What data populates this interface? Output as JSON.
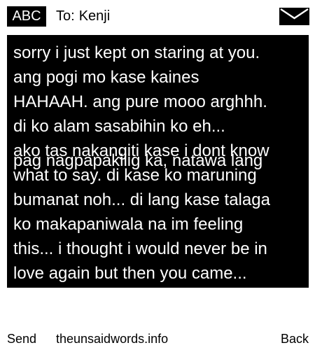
{
  "header": {
    "mode_label": "ABC",
    "to_label": "To:",
    "recipient": "Kenji",
    "icon": "envelope-icon"
  },
  "message": {
    "lines": [
      "sorry i just kept on staring at you.",
      "ang pogi mo kase kaines",
      "HAHAAH. ang pure mooo arghhh.",
      "di ko alam sasabihin ko eh...",
      "pag nagpapakilig ka, natawa lang",
      "ako tas nakangiti kase i dont know",
      "what to say. di kase ko maruning",
      "bumanat noh... di lang kase talaga",
      "ko makapaniwala na im feeling",
      "this... i thought i would never be in",
      "love again but then you came..."
    ]
  },
  "softkeys": {
    "left": "Send",
    "center": "theunsaidwords.info",
    "right": "Back"
  },
  "colors": {
    "background": "#ffffff",
    "message_background": "#000000",
    "message_text": "#ffffff"
  }
}
